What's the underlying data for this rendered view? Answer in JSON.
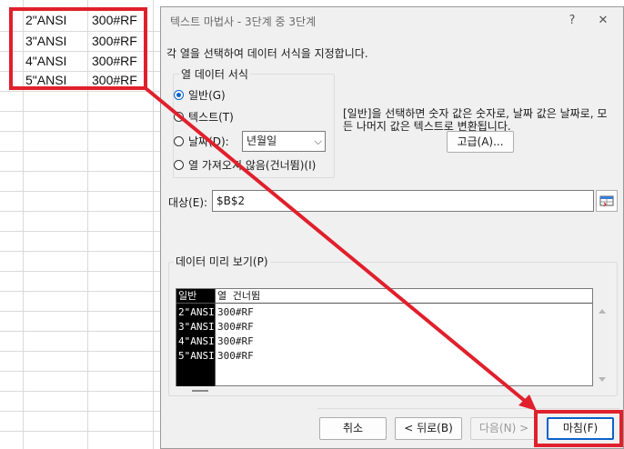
{
  "sheet": {
    "rows": [
      {
        "a": "2\"ANSI",
        "b": "300#RF"
      },
      {
        "a": "3\"ANSI",
        "b": "300#RF"
      },
      {
        "a": "4\"ANSI",
        "b": "300#RF"
      },
      {
        "a": "5\"ANSI",
        "b": "300#RF"
      }
    ]
  },
  "dialog": {
    "title": "텍스트 마법사 - 3단계 중 3단계",
    "help_label": "?",
    "close_label": "✕",
    "instruction": "각 열을 선택하여 데이터 서식을 지정합니다.",
    "format_group": {
      "legend": "열 데이터 서식",
      "options": [
        {
          "label": "일반(G)",
          "selected": true
        },
        {
          "label": "텍스트(T)",
          "selected": false
        },
        {
          "label": "날짜(D):",
          "selected": false
        },
        {
          "label": "열 가져오지 않음(건너뜀)(I)",
          "selected": false
        }
      ],
      "date_format": "년월일",
      "dropdown_arrow": "⌵"
    },
    "description": "[일반]을 선택하면 숫자 값은 숫자로, 날짜 값은 날짜로, 모든 나머지 값은 텍스트로 변환됩니다.",
    "advanced_label": "고급(A)...",
    "destination_label": "대상(E):",
    "destination_value": "$B$2",
    "preview": {
      "legend": "데이터 미리 보기(P)",
      "headers": [
        "일반",
        "열 건너뜀"
      ],
      "rows": [
        [
          "2\"ANSI",
          "300#RF"
        ],
        [
          "3\"ANSI",
          "300#RF"
        ],
        [
          "4\"ANSI",
          "300#RF"
        ],
        [
          "5\"ANSI",
          "300#RF"
        ]
      ]
    },
    "buttons": {
      "cancel": "취소",
      "back": "< 뒤로(B)",
      "next": "다음(N) >",
      "finish": "마침(F)"
    }
  },
  "colors": {
    "annotation_red": "#e0202c",
    "accent_blue": "#0a62c9"
  }
}
